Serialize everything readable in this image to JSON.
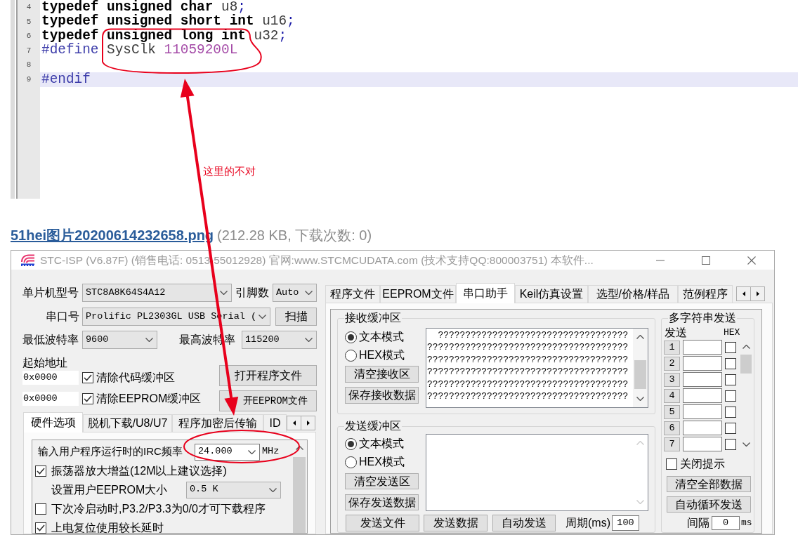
{
  "editor": {
    "lines": [
      {
        "number": "4",
        "current": false,
        "tokens": [
          {
            "kind": "keyword",
            "text": "typedef unsigned char"
          },
          {
            "kind": "identifier",
            "text": "u8"
          },
          {
            "kind": "punct",
            "text": ";"
          }
        ]
      },
      {
        "number": "5",
        "current": false,
        "tokens": [
          {
            "kind": "keyword",
            "text": "typedef unsigned short int"
          },
          {
            "kind": "identifier",
            "text": "u16"
          },
          {
            "kind": "punct",
            "text": ";"
          }
        ]
      },
      {
        "number": "6",
        "current": false,
        "tokens": [
          {
            "kind": "keyword",
            "text": "typedef unsigned long int"
          },
          {
            "kind": "identifier",
            "text": "u32"
          },
          {
            "kind": "punct",
            "text": ";"
          }
        ]
      },
      {
        "number": "7",
        "current": false,
        "tokens": [
          {
            "kind": "directive",
            "text": "#define"
          },
          {
            "kind": "identifier",
            "text": "SysClk"
          },
          {
            "kind": "number",
            "text": "11059200L"
          }
        ]
      },
      {
        "number": "8",
        "current": false
      },
      {
        "number": "9",
        "current": true,
        "tokens": [
          {
            "kind": "directive",
            "text": "#endif"
          }
        ]
      }
    ]
  },
  "annotation": {
    "text": "这里的不对"
  },
  "attachment": {
    "filename": "51hei图片20200614232658.png",
    "info": "(212.28 KB, 下载次数: 0)"
  },
  "window": {
    "title": "STC-ISP (V6.87F) (销售电话: 0513-55012928) 官网:www.STCMCUDATA.com (技术支持QQ:800003751) 本软件..."
  },
  "mcu": {
    "label": "单片机型号",
    "value": "STC8A8K64S4A12"
  },
  "pins": {
    "label": "引脚数",
    "value": "Auto"
  },
  "port": {
    "label": "串口号",
    "value": "Prolific PL2303GL USB Serial (",
    "button": "扫描"
  },
  "min_baud": {
    "label": "最低波特率",
    "value": "9600"
  },
  "max_baud": {
    "label": "最高波特率",
    "value": "115200"
  },
  "start_address": {
    "label": "起始地址",
    "rows": [
      {
        "address": "0x0000",
        "label": "清除代码缓冲区",
        "checked": true,
        "button": "打开程序文件"
      },
      {
        "address": "0x0000",
        "label": "清除EEPROM缓冲区",
        "checked": true,
        "button": "开EEPROM文件"
      }
    ]
  },
  "left_tabs": [
    {
      "label": "硬件选项",
      "selected": true
    },
    {
      "label": "脱机下载/U8/U7",
      "selected": false
    },
    {
      "label": "程序加密后传输",
      "selected": false
    },
    {
      "label": "ID",
      "selected": false
    }
  ],
  "hardware_options": [
    {
      "kind": "combo",
      "label": "输入用户程序运行时的IRC频率",
      "value": "24.000",
      "unit": "MHz"
    },
    {
      "kind": "checkbox",
      "label": "振荡器放大增益(12M以上建议选择)",
      "checked": true
    },
    {
      "kind": "select",
      "label": "设置用户EEPROM大小",
      "value": "0.5 K"
    },
    {
      "kind": "checkbox",
      "label": "下次冷启动时,P3.2/P3.3为0/0才可下载程序",
      "checked": false
    },
    {
      "kind": "checkbox",
      "label": "上电复位使用较长延时",
      "checked": true
    }
  ],
  "right_tabs": [
    {
      "label": "程序文件",
      "selected": false
    },
    {
      "label": "EEPROM文件",
      "selected": false
    },
    {
      "label": "串口助手",
      "selected": true
    },
    {
      "label": "Keil仿真设置",
      "selected": false
    },
    {
      "label": "选型/价格/样品",
      "selected": false
    },
    {
      "label": "范例程序",
      "selected": false
    }
  ],
  "receive": {
    "title": "接收缓冲区",
    "modes": [
      {
        "label": "文本模式",
        "selected": true
      },
      {
        "label": "HEX模式",
        "selected": false
      }
    ],
    "buttons": [
      "清空接收区",
      "保存接收数据"
    ],
    "lines": [
      "???????????????????????????????????",
      "?????????????????????????????????????",
      "?????????????????????????????????????",
      "?????????????????????????????????????",
      "?????????????????????????????????????",
      "?????????????????????????????????????"
    ]
  },
  "send": {
    "title": "发送缓冲区",
    "modes": [
      {
        "label": "文本模式",
        "selected": true
      },
      {
        "label": "HEX模式",
        "selected": false
      }
    ],
    "buttons": [
      "清空发送区",
      "保存发送数据"
    ],
    "actions": [
      "发送文件",
      "发送数据",
      "自动发送"
    ],
    "period": {
      "label": "周期(ms)",
      "value": "100"
    }
  },
  "multi_send": {
    "title": "多字符串发送",
    "send_label": "发送",
    "hex_label": "HEX",
    "rows": [
      {
        "number": "1",
        "hex": false
      },
      {
        "number": "2",
        "hex": false
      },
      {
        "number": "3",
        "hex": false
      },
      {
        "number": "4",
        "hex": false
      },
      {
        "number": "5",
        "hex": false
      },
      {
        "number": "6",
        "hex": false
      },
      {
        "number": "7",
        "hex": false
      }
    ],
    "close_tips": {
      "label": "关闭提示",
      "checked": false
    },
    "buttons": [
      "清空全部数据",
      "自动循环发送"
    ],
    "interval": {
      "label": "间隔",
      "value": "0",
      "unit": "ms"
    }
  }
}
